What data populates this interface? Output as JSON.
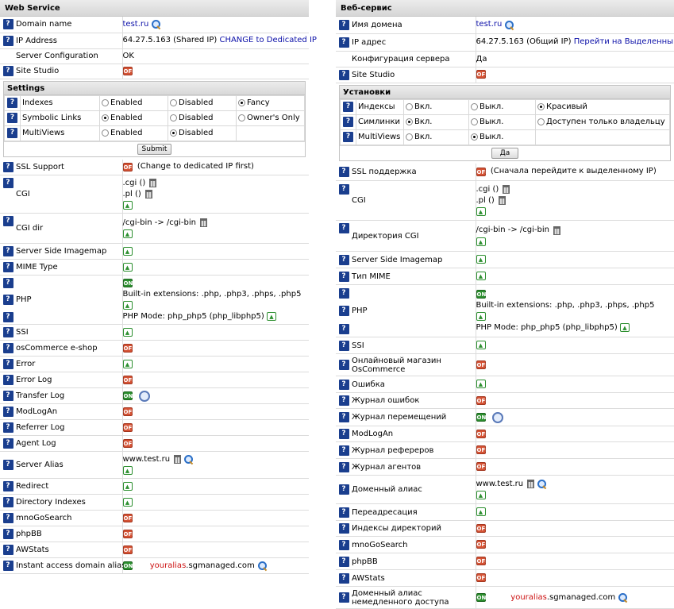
{
  "left": {
    "title": "Web Service",
    "domain_label": "Domain name",
    "domain_value": "test.ru",
    "ip_label": "IP Address",
    "ip_value": "64.27.5.163 (Shared IP)",
    "ip_link": "CHANGE to Dedicated IP",
    "server_config_label": "Server Configuration",
    "server_config_value": "OK",
    "site_studio_label": "Site Studio",
    "settings_title": "Settings",
    "indexes_label": "Indexes",
    "symlinks_label": "Symbolic Links",
    "multiviews_label": "MultiViews",
    "enabled": "Enabled",
    "disabled": "Disabled",
    "fancy": "Fancy",
    "owners_only": "Owner's Only",
    "submit": "Submit",
    "ssl_label": "SSL Support",
    "ssl_value": "(Change to dedicated IP first)",
    "cgi_label": "CGI",
    "cgi_ext1": ".cgi ()",
    "cgi_ext2": ".pl ()",
    "cgidir_label": "CGI dir",
    "cgidir_value": "/cgi-bin -> /cgi-bin",
    "imagemap_label": "Server Side Imagemap",
    "mime_label": "MIME Type",
    "php_label": "PHP",
    "php_ext": "Built-in extensions: .php, .php3, .phps, .php5",
    "php_mode": "PHP Mode: php_php5 (php_libphp5)",
    "ssi_label": "SSI",
    "oscommerce_label": "osCommerce e-shop",
    "error_label": "Error",
    "errorlog_label": "Error Log",
    "transferlog_label": "Transfer Log",
    "modlogan_label": "ModLogAn",
    "referrerlog_label": "Referrer Log",
    "agentlog_label": "Agent Log",
    "alias_label": "Server Alias",
    "alias_value": "www.test.ru",
    "redirect_label": "Redirect",
    "dirindex_label": "Directory Indexes",
    "mnogo_label": "mnoGoSearch",
    "phpbb_label": "phpBB",
    "awstats_label": "AWStats",
    "instant_label": "Instant access domain alias",
    "instant_alias_red": "youralias",
    "instant_alias_rest": ".sgmanaged.com"
  },
  "right": {
    "title": "Веб-сервис",
    "domain_label": "Имя домена",
    "domain_value": "test.ru",
    "ip_label": "IP адрес",
    "ip_value": "64.27.5.163 (Общий IP)",
    "ip_link": "Перейти на Выделенный IP",
    "server_config_label": "Конфигурация сервера",
    "server_config_value": "Да",
    "site_studio_label": "Site Studio",
    "settings_title": "Установки",
    "indexes_label": "Индексы",
    "symlinks_label": "Симлинки",
    "multiviews_label": "MultiViews",
    "enabled": "Вкл.",
    "disabled": "Выкл.",
    "fancy": "Красивый",
    "owners_only": "Доступен только владельцу",
    "submit": "Да",
    "ssl_label": "SSL поддержка",
    "ssl_value": "(Сначала перейдите к выделенному IP)",
    "cgi_label": "CGI",
    "cgi_ext1": ".cgi ()",
    "cgi_ext2": ".pl ()",
    "cgidir_label": "Директория CGI",
    "cgidir_value": "/cgi-bin -> /cgi-bin",
    "imagemap_label": "Server Side Imagemap",
    "mime_label": "Тип MIME",
    "php_label": "PHP",
    "php_ext": "Built-in extensions: .php, .php3, .phps, .php5",
    "php_mode": "PHP Mode: php_php5 (php_libphp5)",
    "ssi_label": "SSI",
    "oscommerce_label": "Онлайновый магазин OsCommerce",
    "error_label": "Ошибка",
    "errorlog_label": "Журнал ошибок",
    "transferlog_label": "Журнал перемещений",
    "modlogan_label": "ModLogAn",
    "referrerlog_label": "Журнал рефереров",
    "agentlog_label": "Журнал агентов",
    "alias_label": "Доменный алиас",
    "alias_value": "www.test.ru",
    "redirect_label": "Переадресация",
    "dirindex_label": "Индексы директорий",
    "mnogo_label": "mnoGoSearch",
    "phpbb_label": "phpBB",
    "awstats_label": "AWStats",
    "instant_label": "Доменный алиас немедленного доступа",
    "instant_alias_red": "youralias",
    "instant_alias_rest": ".sgmanaged.com"
  },
  "icons": {
    "help": "?",
    "on": "ON",
    "off": "OFF",
    "up": "▲"
  }
}
